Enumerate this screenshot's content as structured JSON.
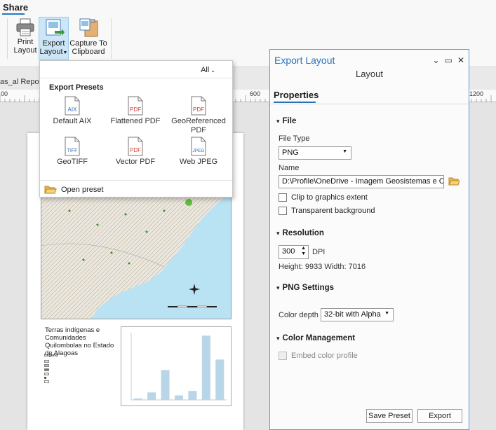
{
  "ribbon": {
    "tab": "Share",
    "print": [
      "Print",
      "Layout"
    ],
    "export": [
      "Export",
      "Layout"
    ],
    "capture": [
      "Capture To",
      "Clipboard"
    ]
  },
  "layout_tab": "as_al Repor",
  "ruler": {
    "left": "00",
    "mid": "600",
    "right": "1200"
  },
  "dropdown": {
    "filter": "All",
    "heading": "Export Presets",
    "presets": [
      {
        "label": "Default AIX",
        "glyph": "AIX",
        "color": "#2a6ebb"
      },
      {
        "label": "Flattened PDF",
        "glyph": "PDF",
        "color": "#d0463a"
      },
      {
        "label": "GeoReferenced PDF",
        "glyph": "PDF",
        "color": "#d0463a"
      },
      {
        "label": "GeoTIFF",
        "glyph": "TIFF",
        "color": "#2a6ebb"
      },
      {
        "label": "Vector PDF",
        "glyph": "PDF",
        "color": "#d0463a"
      },
      {
        "label": "Web JPEG",
        "glyph": "JPEG",
        "color": "#2a6ebb"
      }
    ],
    "open_preset": "Open preset"
  },
  "page": {
    "map_title": "Terras indígenas e Comunidades Quilombolas no Estado de Alagoas",
    "legend_title": "Legend"
  },
  "chart_data": {
    "type": "bar",
    "categories": [
      "",
      "",
      "",
      "",
      "",
      "",
      ""
    ],
    "values": [
      1,
      5,
      20,
      3,
      6,
      43,
      27
    ],
    "ylim": [
      0,
      45
    ],
    "color": "#b9d6e8"
  },
  "panel": {
    "title": "Export Layout",
    "subtitle": "Layout",
    "tab": "Properties",
    "file": {
      "section": "File",
      "type_label": "File Type",
      "type_value": "PNG",
      "name_label": "Name",
      "name_value": "D:\\Profile\\OneDrive - Imagem Geosistemas e Com",
      "clip": "Clip to graphics extent",
      "transparent": "Transparent background"
    },
    "resolution": {
      "section": "Resolution",
      "dpi_value": "300",
      "dpi_label": "DPI",
      "dims": "Height: 9933 Width: 7016"
    },
    "png": {
      "section": "PNG Settings",
      "depth_label": "Color depth",
      "depth_value": "32-bit with Alpha"
    },
    "color": {
      "section": "Color Management",
      "embed": "Embed color profile"
    },
    "save_preset": "Save Preset",
    "export": "Export"
  }
}
